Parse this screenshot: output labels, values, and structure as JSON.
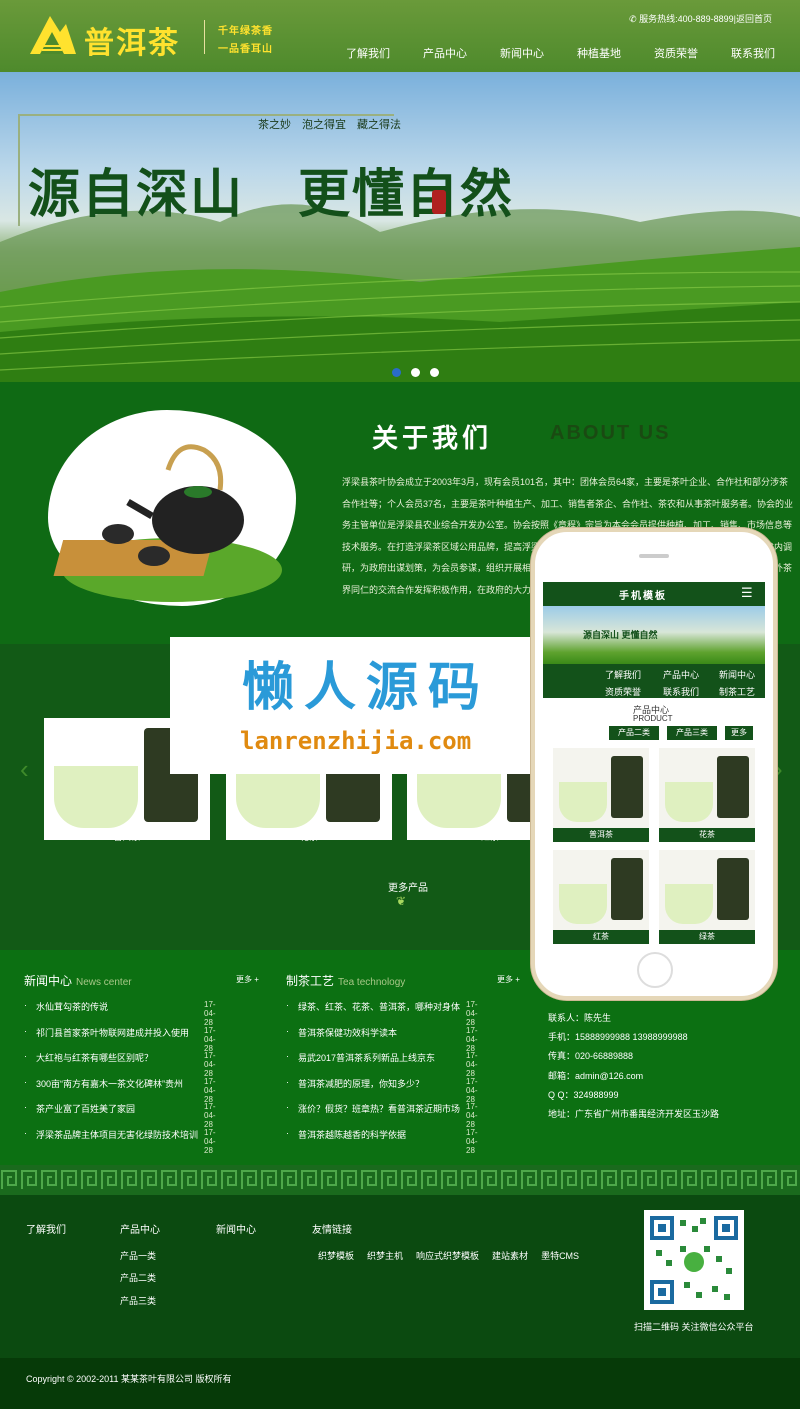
{
  "header": {
    "logo_text": "普洱茶",
    "slogan_line1": "千年绿茶香",
    "slogan_line2": "一品香耳山",
    "hotline": "服务热线:400-889-8899|返回首页",
    "nav": [
      "了解我们",
      "产品中心",
      "新闻中心",
      "种植基地",
      "资质荣誉",
      "联系我们"
    ]
  },
  "banner": {
    "small_title": "茶之妙　泡之得宜　藏之得法",
    "big_title": "源自深山　更懂自然",
    "slides": 3,
    "active_slide": 1
  },
  "about": {
    "title_cn": "关于我们",
    "title_en": "ABOUT US",
    "paragraph": "浮梁县茶叶协会成立于2003年3月，现有会员101名，其中：团体会员64家，主要是茶叶企业、合作社和部分涉茶合作社等；个人会员37名，主要是茶叶种植生产、加工、销售者茶企、合作社、茶农和从事茶叶服务者。协会的业务主管单位是浮梁县农业综合开发办公室。协会按照《章程》宗旨为本会会员提供种植、加工、销售、市场信息等技术服务。在打造浮梁茶区域公用品牌，提高浮梁茶叶知名度方面积极出谋划策，为政府组织会员到省外、省内调研，为政府出谋划策，为会员参谋，组织开展相关工作，开展茶叶交易、茶文化、茶叶技术交流和开展与国内外茶界同仁的交流合作发挥积极作用，在政府的大力支持下，浮梁先后获中国文化名茶、中国红茶之乡"
  },
  "products": {
    "items": [
      "普洱茶",
      "花茶",
      "红茶"
    ],
    "more": "更多产品"
  },
  "watermark": {
    "cn": "懒人源码",
    "url": "lanrenzhijia.com"
  },
  "mobile": {
    "title": "手机模板",
    "banner_text": "源自深山 更懂自然",
    "nav": [
      "了解我们",
      "产品中心",
      "新闻中心",
      "资质荣誉",
      "联系我们",
      "制茶工艺"
    ],
    "section_cn": "产品中心",
    "section_en": "PRODUCT",
    "tabs": [
      "产品二类",
      "产品三类",
      "更多"
    ],
    "items": [
      "普洱茶",
      "花茶",
      "红茶",
      "绿茶"
    ]
  },
  "news": {
    "title": "新闻中心",
    "title_en": "News center",
    "more": "更多 +",
    "items": [
      {
        "t": "水仙茸勾茶的传说",
        "d": "17-04-28"
      },
      {
        "t": "祁门县首家茶叶物联网建成并投入使用",
        "d": "17-04-28"
      },
      {
        "t": "大红袍与红茶有哪些区别呢？",
        "d": "17-04-28"
      },
      {
        "t": "300亩“南方有嘉木一茶文化碑林”贵州",
        "d": "17-04-28"
      },
      {
        "t": "茶产业富了百姓美了家园",
        "d": "17-04-28"
      },
      {
        "t": "浮梁茶品牌主体项目无害化绿防技术培训",
        "d": "17-04-28"
      }
    ]
  },
  "craft": {
    "title": "制茶工艺",
    "title_en": "Tea technology",
    "more": "更多 +",
    "items": [
      {
        "t": "绿茶、红茶、花茶、普洱茶，哪种对身体",
        "d": "17-04-28"
      },
      {
        "t": "普洱茶保健功效科学读本",
        "d": "17-04-28"
      },
      {
        "t": "易武2017普洱茶系列新品上线京东",
        "d": "17-04-28"
      },
      {
        "t": "普洱茶减肥的原理，你知多少？",
        "d": "17-04-28"
      },
      {
        "t": "涨价？假货？班章热？看普洱茶近期市场",
        "d": "17-04-28"
      },
      {
        "t": "普洱茶越陈越香的科学依据",
        "d": "17-04-28"
      }
    ]
  },
  "contact": {
    "lines": [
      "联系人：陈先生",
      "手机：15888999988 13988999988",
      "传真：020-66889888",
      "邮箱：admin@126.com",
      "Q Q：324988999",
      "地址：广东省广州市番禺经济开发区玉沙路"
    ]
  },
  "footer": {
    "col1_title": "了解我们",
    "col2_title": "产品中心",
    "col2_links": [
      "产品一类",
      "产品二类",
      "产品三类"
    ],
    "col3_title": "新闻中心",
    "col4_title": "友情链接",
    "col4_links": [
      "织梦模板",
      "织梦主机",
      "响应式织梦模板",
      "建站素材",
      "墨特CMS"
    ],
    "qr_caption": "扫描二维码 关注微信公众平台",
    "copyright": "Copyright © 2002-2011 某某茶叶有限公司 版权所有"
  },
  "colors": {
    "brand_green": "#0f6a14",
    "logo_yellow": "#ffe22e",
    "dark_footer": "#063a08"
  }
}
